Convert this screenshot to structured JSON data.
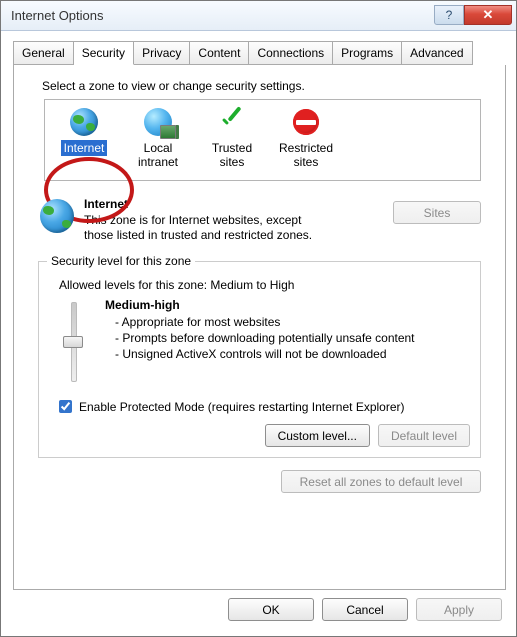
{
  "window": {
    "title": "Internet Options"
  },
  "tabs": [
    {
      "label": "General"
    },
    {
      "label": "Security"
    },
    {
      "label": "Privacy"
    },
    {
      "label": "Content"
    },
    {
      "label": "Connections"
    },
    {
      "label": "Programs"
    },
    {
      "label": "Advanced"
    }
  ],
  "active_tab": 1,
  "zone_heading": "Select a zone to view or change security settings.",
  "zones": [
    {
      "label": "Internet",
      "icon": "globe-icon"
    },
    {
      "label": "Local intranet",
      "icon": "globe-net-icon"
    },
    {
      "label": "Trusted sites",
      "icon": "check-icon"
    },
    {
      "label": "Restricted sites",
      "icon": "noentry-icon"
    }
  ],
  "selected_zone": 0,
  "zone_detail": {
    "name": "Internet",
    "blurb": "This zone is for Internet websites, except those listed in trusted and restricted zones.",
    "sites_button": "Sites",
    "sites_enabled": false
  },
  "security": {
    "group_label": "Security level for this zone",
    "allowed": "Allowed levels for this zone: Medium to High",
    "level_name": "Medium-high",
    "bullets": [
      "- Appropriate for most websites",
      "- Prompts before downloading potentially unsafe content",
      "- Unsigned ActiveX controls will not be downloaded"
    ],
    "protected_checked": true,
    "protected_label": "Enable Protected Mode (requires restarting Internet Explorer)",
    "custom_button": "Custom level...",
    "default_button": "Default level",
    "default_enabled": false
  },
  "reset_button": "Reset all zones to default level",
  "reset_enabled": false,
  "bottom": {
    "ok": "OK",
    "cancel": "Cancel",
    "apply": "Apply",
    "apply_enabled": false
  }
}
